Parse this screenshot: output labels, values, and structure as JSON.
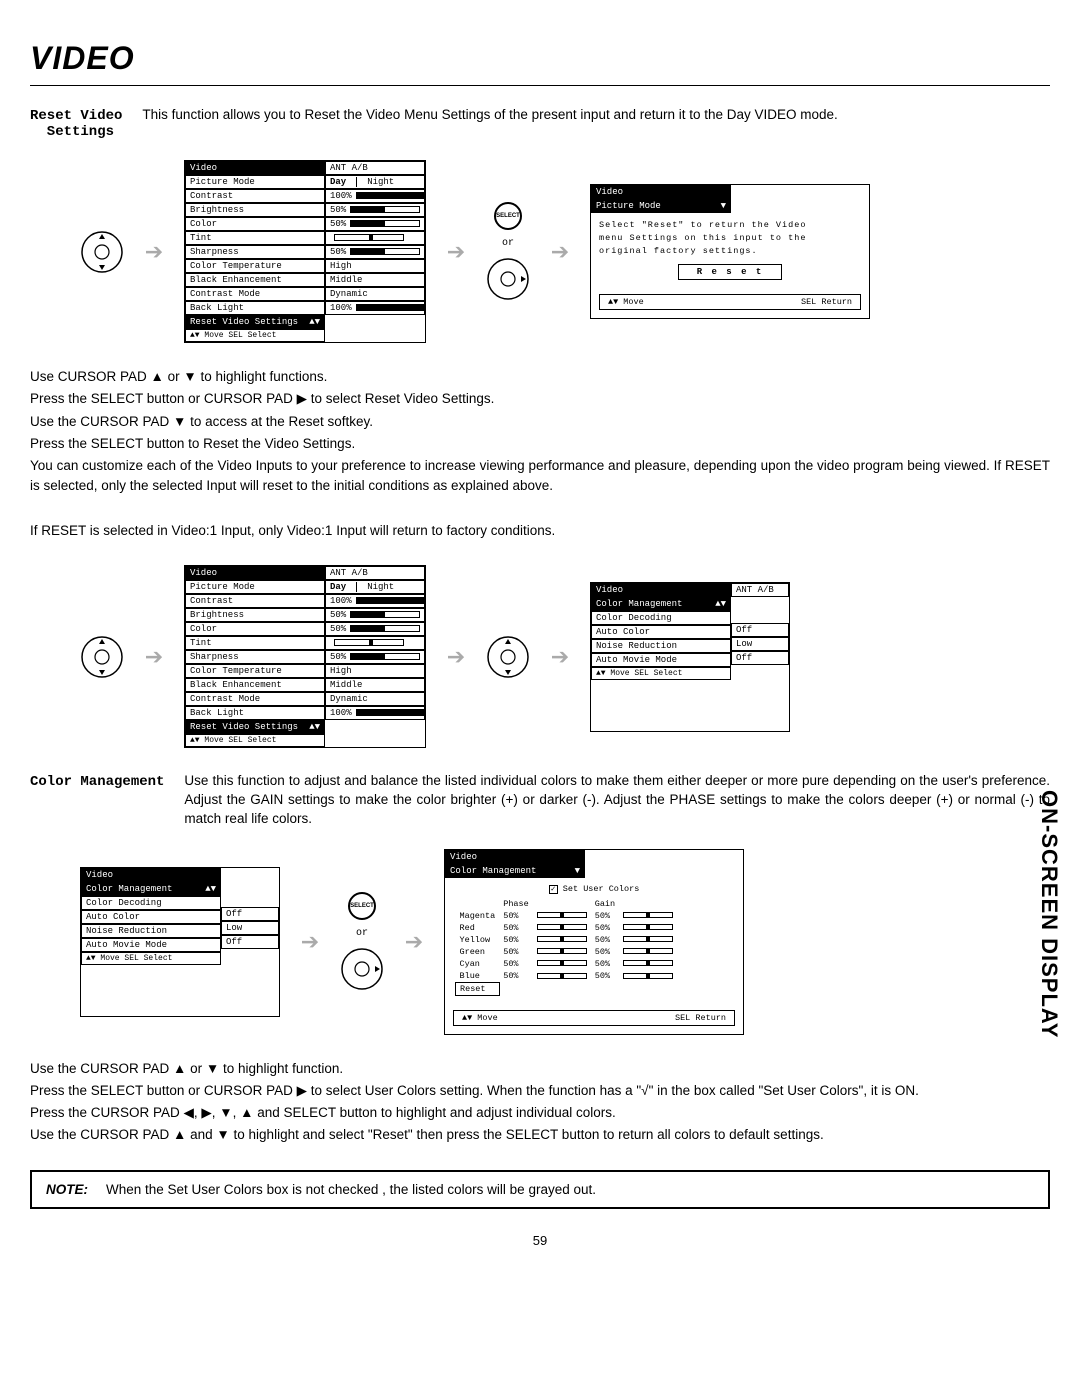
{
  "page": {
    "title": "VIDEO",
    "side_tab": "ON-SCREEN DISPLAY",
    "number": "59"
  },
  "section1": {
    "label": "Reset Video\n  Settings",
    "desc": "This function allows you to Reset the Video Menu Settings of the present input and return it to the Day VIDEO mode."
  },
  "video_menu": {
    "header": "Video",
    "ant": "ANT A/B",
    "day": "Day",
    "night": "Night",
    "rows": [
      {
        "k": "Picture Mode",
        "v": ""
      },
      {
        "k": "Contrast",
        "v": "100%",
        "fill": 100
      },
      {
        "k": "Brightness",
        "v": "50%",
        "fill": 50
      },
      {
        "k": "Color",
        "v": "50%",
        "fill": 50
      },
      {
        "k": "Tint",
        "v": "",
        "mark": 50
      },
      {
        "k": "Sharpness",
        "v": "50%",
        "fill": 50
      },
      {
        "k": "Color Temperature",
        "v": "High"
      },
      {
        "k": "Black Enhancement",
        "v": "Middle"
      },
      {
        "k": "Contrast Mode",
        "v": "Dynamic"
      },
      {
        "k": "Back Light",
        "v": "100%",
        "fill": 100
      },
      {
        "k": "Reset Video Settings",
        "v": "",
        "hl": true
      }
    ],
    "help": "▲▼ Move  SEL Select"
  },
  "reset_dialog": {
    "header": "Video",
    "sub": "Picture Mode",
    "msg1": "Select  \"Reset\"  to  return  the  Video",
    "msg2": "menu  Settings  on  this  input  to  the",
    "msg3": "original  factory  settings.",
    "btn": "R e s e t",
    "move": "▲▼ Move",
    "ret": "SEL Return"
  },
  "instr1": [
    "Use CURSOR PAD ▲ or ▼ to highlight functions.",
    "Press the SELECT button or CURSOR PAD ▶ to select Reset Video Settings.",
    "Use the CURSOR PAD ▼ to access at the Reset softkey.",
    "Press the SELECT button to Reset the Video Settings.",
    "You can customize each of the Video Inputs to your preference to increase viewing performance and pleasure, depending upon the video program being viewed. If RESET is selected, only the selected Input will reset to the initial conditions as explained above.",
    "",
    "If RESET is selected in Video:1 Input, only Video:1 Input will return to factory conditions."
  ],
  "cm_menu": {
    "header": "Video",
    "ant": "ANT A/B",
    "rows": [
      {
        "k": "Color Management",
        "hl": true
      },
      {
        "k": "Color Decoding",
        "v": ""
      },
      {
        "k": "Auto Color",
        "v": "Off"
      },
      {
        "k": "Noise Reduction",
        "v": "Low"
      },
      {
        "k": "Auto Movie Mode",
        "v": "Off"
      }
    ],
    "help": "▲▼ Move  SEL Select"
  },
  "section2": {
    "label": "Color Management",
    "desc": "Use this function to adjust and balance the listed individual colors to make them either deeper or more pure depending on the user's preference.  Adjust the GAIN settings to make the color brighter (+) or darker (-).  Adjust the PHASE settings to make the colors deeper (+) or normal (-) to match real life colors."
  },
  "cm_detail": {
    "header": "Video",
    "sub": "Color Management",
    "check_label": "Set User Colors",
    "phase": "Phase",
    "gain": "Gain",
    "colors": [
      "Magenta",
      "Red",
      "Yellow",
      "Green",
      "Cyan",
      "Blue"
    ],
    "val": "50%",
    "reset": "Reset",
    "move": "▲▼ Move",
    "ret": "SEL Return"
  },
  "instr2": [
    "Use the CURSOR PAD ▲ or ▼ to highlight function.",
    "Press the SELECT button or CURSOR PAD ▶ to select User Colors setting.  When the function has a \"√\" in the box called \"Set User Colors\", it is ON.",
    "Press  the CURSOR PAD ◀, ▶, ▼, ▲ and SELECT button to highlight and adjust individual colors.",
    "Use  the CURSOR PAD ▲ and ▼ to highlight and select \"Reset\" then press the SELECT button to return all colors to default settings."
  ],
  "note": {
    "label": "NOTE:",
    "text": "When the Set User Colors box is not checked , the listed colors will be grayed out."
  },
  "arrow": "➔",
  "or": "or",
  "select": "SELECT"
}
